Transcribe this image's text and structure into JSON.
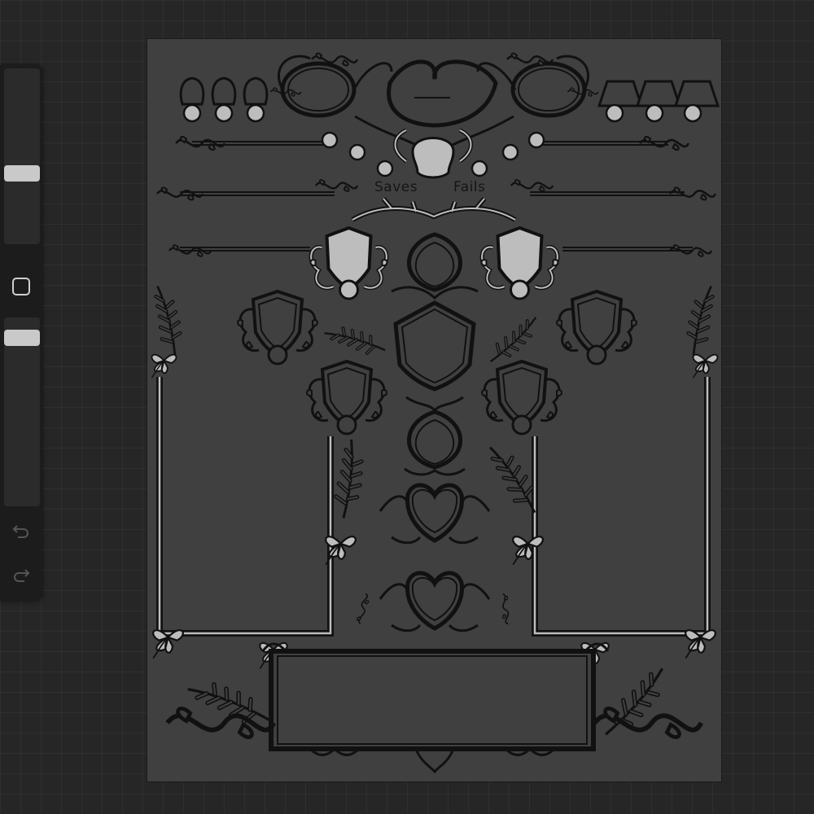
{
  "app": {
    "sidebar": {
      "tools": [
        "brush-size-slider",
        "modify-button",
        "opacity-slider",
        "undo-button",
        "redo-button"
      ],
      "icons": {
        "undo": "undo-arrow-icon",
        "redo": "redo-arrow-icon",
        "modify": "square-icon"
      }
    }
  },
  "sheet": {
    "death_saves": {
      "saves_label": "Saves",
      "fails_label": "Fails"
    }
  },
  "colors": {
    "background": "#262626",
    "canvas": "#404040",
    "line_art": "#111111",
    "highlight": "#bdbdbd"
  }
}
